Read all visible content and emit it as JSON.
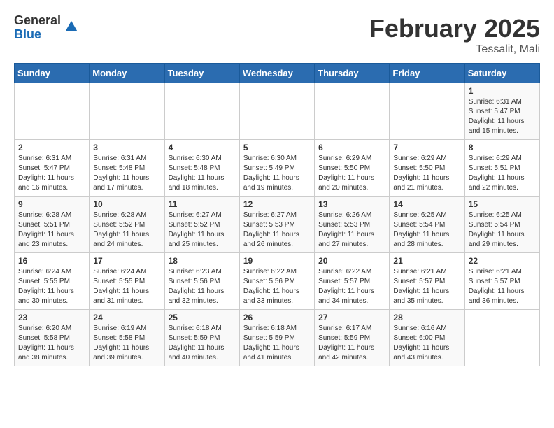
{
  "header": {
    "logo_general": "General",
    "logo_blue": "Blue",
    "title": "February 2025",
    "subtitle": "Tessalit, Mali"
  },
  "weekdays": [
    "Sunday",
    "Monday",
    "Tuesday",
    "Wednesday",
    "Thursday",
    "Friday",
    "Saturday"
  ],
  "weeks": [
    [
      {
        "day": "",
        "info": ""
      },
      {
        "day": "",
        "info": ""
      },
      {
        "day": "",
        "info": ""
      },
      {
        "day": "",
        "info": ""
      },
      {
        "day": "",
        "info": ""
      },
      {
        "day": "",
        "info": ""
      },
      {
        "day": "1",
        "info": "Sunrise: 6:31 AM\nSunset: 5:47 PM\nDaylight: 11 hours\nand 15 minutes."
      }
    ],
    [
      {
        "day": "2",
        "info": "Sunrise: 6:31 AM\nSunset: 5:47 PM\nDaylight: 11 hours\nand 16 minutes."
      },
      {
        "day": "3",
        "info": "Sunrise: 6:31 AM\nSunset: 5:48 PM\nDaylight: 11 hours\nand 17 minutes."
      },
      {
        "day": "4",
        "info": "Sunrise: 6:30 AM\nSunset: 5:48 PM\nDaylight: 11 hours\nand 18 minutes."
      },
      {
        "day": "5",
        "info": "Sunrise: 6:30 AM\nSunset: 5:49 PM\nDaylight: 11 hours\nand 19 minutes."
      },
      {
        "day": "6",
        "info": "Sunrise: 6:29 AM\nSunset: 5:50 PM\nDaylight: 11 hours\nand 20 minutes."
      },
      {
        "day": "7",
        "info": "Sunrise: 6:29 AM\nSunset: 5:50 PM\nDaylight: 11 hours\nand 21 minutes."
      },
      {
        "day": "8",
        "info": "Sunrise: 6:29 AM\nSunset: 5:51 PM\nDaylight: 11 hours\nand 22 minutes."
      }
    ],
    [
      {
        "day": "9",
        "info": "Sunrise: 6:28 AM\nSunset: 5:51 PM\nDaylight: 11 hours\nand 23 minutes."
      },
      {
        "day": "10",
        "info": "Sunrise: 6:28 AM\nSunset: 5:52 PM\nDaylight: 11 hours\nand 24 minutes."
      },
      {
        "day": "11",
        "info": "Sunrise: 6:27 AM\nSunset: 5:52 PM\nDaylight: 11 hours\nand 25 minutes."
      },
      {
        "day": "12",
        "info": "Sunrise: 6:27 AM\nSunset: 5:53 PM\nDaylight: 11 hours\nand 26 minutes."
      },
      {
        "day": "13",
        "info": "Sunrise: 6:26 AM\nSunset: 5:53 PM\nDaylight: 11 hours\nand 27 minutes."
      },
      {
        "day": "14",
        "info": "Sunrise: 6:25 AM\nSunset: 5:54 PM\nDaylight: 11 hours\nand 28 minutes."
      },
      {
        "day": "15",
        "info": "Sunrise: 6:25 AM\nSunset: 5:54 PM\nDaylight: 11 hours\nand 29 minutes."
      }
    ],
    [
      {
        "day": "16",
        "info": "Sunrise: 6:24 AM\nSunset: 5:55 PM\nDaylight: 11 hours\nand 30 minutes."
      },
      {
        "day": "17",
        "info": "Sunrise: 6:24 AM\nSunset: 5:55 PM\nDaylight: 11 hours\nand 31 minutes."
      },
      {
        "day": "18",
        "info": "Sunrise: 6:23 AM\nSunset: 5:56 PM\nDaylight: 11 hours\nand 32 minutes."
      },
      {
        "day": "19",
        "info": "Sunrise: 6:22 AM\nSunset: 5:56 PM\nDaylight: 11 hours\nand 33 minutes."
      },
      {
        "day": "20",
        "info": "Sunrise: 6:22 AM\nSunset: 5:57 PM\nDaylight: 11 hours\nand 34 minutes."
      },
      {
        "day": "21",
        "info": "Sunrise: 6:21 AM\nSunset: 5:57 PM\nDaylight: 11 hours\nand 35 minutes."
      },
      {
        "day": "22",
        "info": "Sunrise: 6:21 AM\nSunset: 5:57 PM\nDaylight: 11 hours\nand 36 minutes."
      }
    ],
    [
      {
        "day": "23",
        "info": "Sunrise: 6:20 AM\nSunset: 5:58 PM\nDaylight: 11 hours\nand 38 minutes."
      },
      {
        "day": "24",
        "info": "Sunrise: 6:19 AM\nSunset: 5:58 PM\nDaylight: 11 hours\nand 39 minutes."
      },
      {
        "day": "25",
        "info": "Sunrise: 6:18 AM\nSunset: 5:59 PM\nDaylight: 11 hours\nand 40 minutes."
      },
      {
        "day": "26",
        "info": "Sunrise: 6:18 AM\nSunset: 5:59 PM\nDaylight: 11 hours\nand 41 minutes."
      },
      {
        "day": "27",
        "info": "Sunrise: 6:17 AM\nSunset: 5:59 PM\nDaylight: 11 hours\nand 42 minutes."
      },
      {
        "day": "28",
        "info": "Sunrise: 6:16 AM\nSunset: 6:00 PM\nDaylight: 11 hours\nand 43 minutes."
      },
      {
        "day": "",
        "info": ""
      }
    ]
  ]
}
